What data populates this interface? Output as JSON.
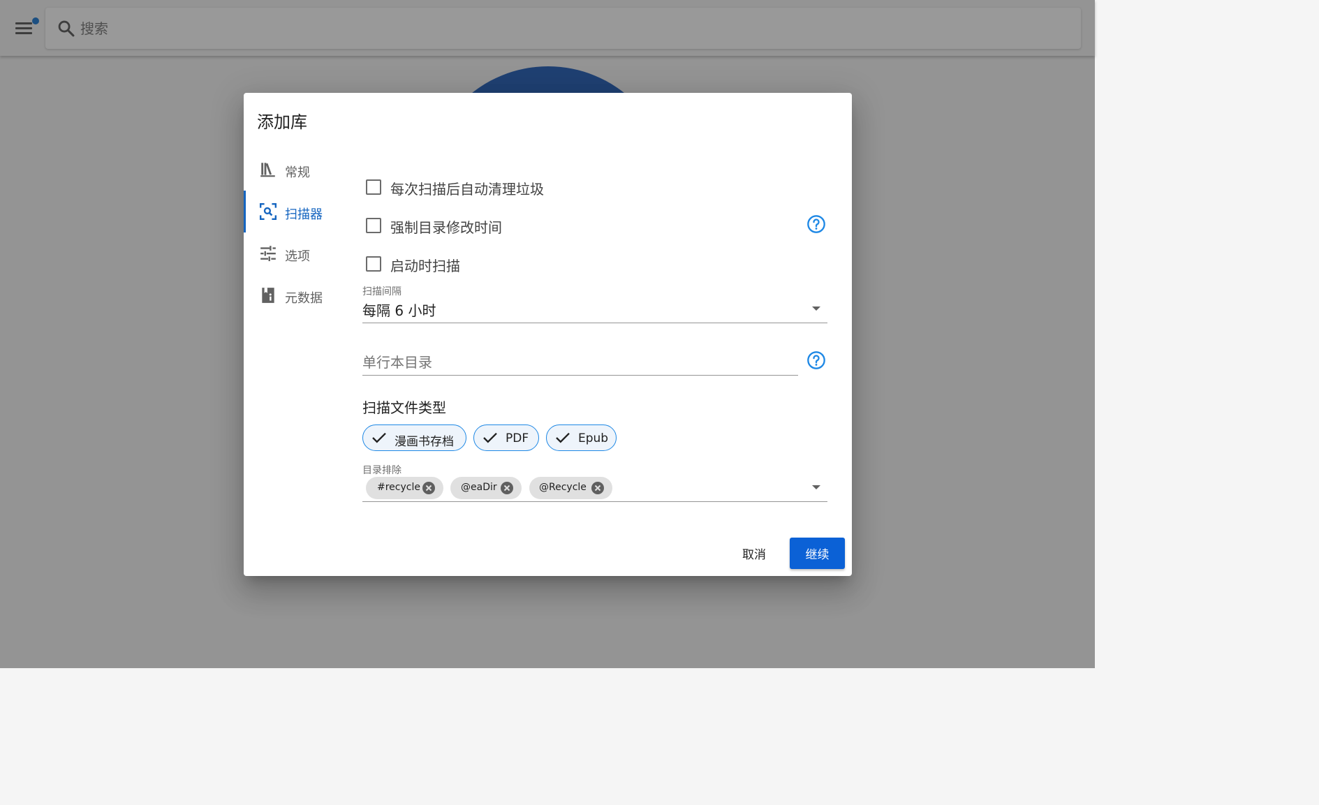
{
  "appbar": {
    "search": {
      "placeholder": "搜索"
    }
  },
  "dialog": {
    "title": "添加库",
    "tabs": [
      {
        "label": "常规",
        "icon": "library-books-icon",
        "active": false
      },
      {
        "label": "扫描器",
        "icon": "scan-search-icon",
        "active": true
      },
      {
        "label": "选项",
        "icon": "tune-sliders-icon",
        "active": false
      },
      {
        "label": "元数据",
        "icon": "book-info-icon",
        "active": false
      }
    ],
    "scanner": {
      "checkboxes": [
        {
          "label": "每次扫描后自动清理垃圾",
          "checked": false
        },
        {
          "label": "强制目录修改时间",
          "checked": false,
          "help": true
        },
        {
          "label": "启动时扫描",
          "checked": false
        }
      ],
      "scan_interval": {
        "label": "扫描间隔",
        "value": "每隔 6 小时"
      },
      "oneshots_dir": {
        "label": "单行本目录",
        "value": ""
      },
      "file_types": {
        "heading": "扫描文件类型",
        "chips": [
          {
            "label": "漫画书存档",
            "selected": true
          },
          {
            "label": "PDF",
            "selected": true
          },
          {
            "label": "Epub",
            "selected": true
          }
        ]
      },
      "dir_exclusions": {
        "label": "目录排除",
        "chips": [
          "#recycle",
          "@eaDir",
          "@Recycle"
        ]
      }
    },
    "actions": {
      "cancel": "取消",
      "continue": "继续"
    }
  },
  "colors": {
    "accent": "#1565c0",
    "primary_button": "#0b61d6",
    "help_icon": "#1e88e5",
    "notification_dot": "#1976d2",
    "background_circle": "#1e5bb8"
  }
}
